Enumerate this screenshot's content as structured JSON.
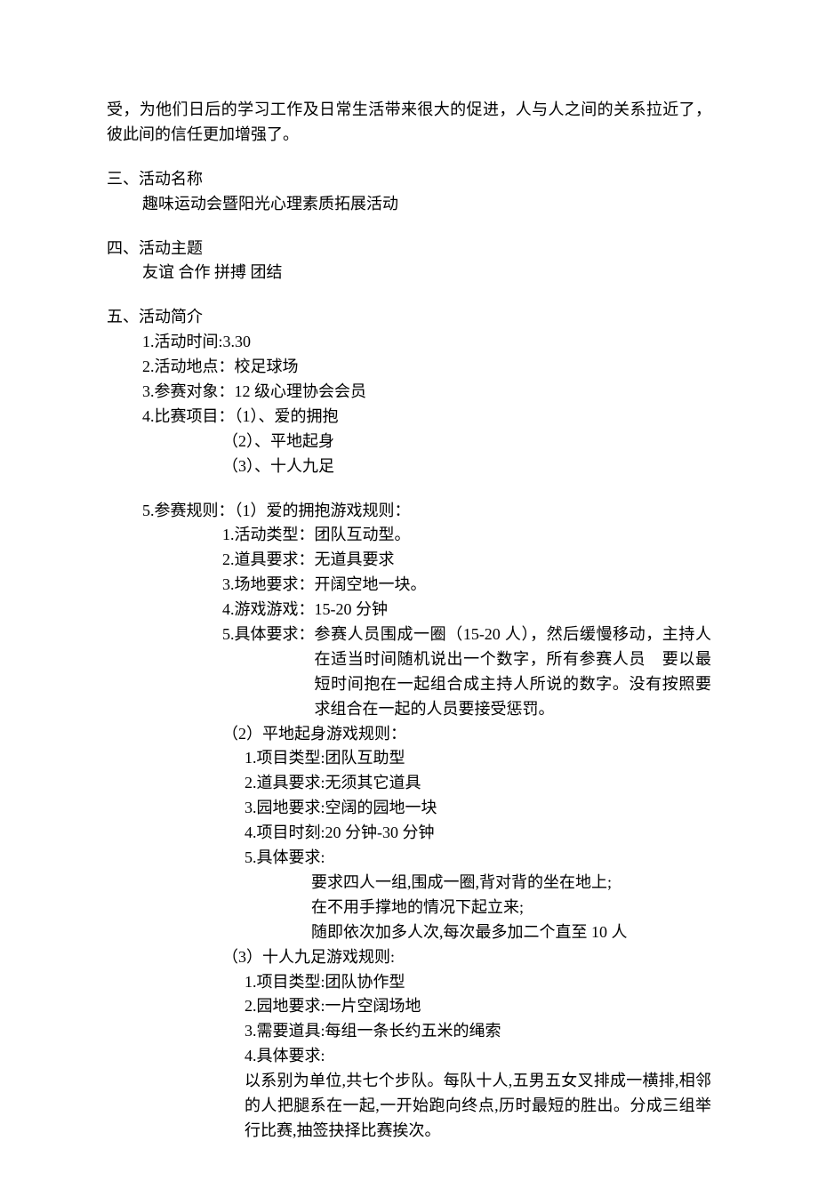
{
  "intro_para": "受，为他们日后的学习工作及日常生活带来很大的促进，人与人之间的关系拉近了，彼此间的信任更加增强了。",
  "s3": {
    "heading": "三、活动名称",
    "body": "趣味运动会暨阳光心理素质拓展活动"
  },
  "s4": {
    "heading": "四、活动主题",
    "body": "友谊 合作 拼搏 团结"
  },
  "s5": {
    "heading": "五、活动简介",
    "item1": "1.活动时间:3.30",
    "item2": "2.活动地点：校足球场",
    "item3": "3.参赛对象：12 级心理协会会员",
    "item4": "4.比赛项目：（1）、爱的拥抱",
    "item4b": "（2）、平地起身",
    "item4c": "（3）、十人九足",
    "item5": "5.参赛规则：（1）爱的拥抱游戏规则：",
    "g1": {
      "l1": "1.活动类型：团队互动型。",
      "l2": "2.道具要求：无道具要求",
      "l3": "3.场地要求：开阔空地一块。",
      "l4": "4.游戏游戏：15-20 分钟",
      "l5label": "5.具体要求：",
      "l5body": "参赛人员围成一圈（15-20 人），然后缓慢移动，主持人在适当时间随机说出一个数字，所有参赛人员　要以最短时间抱在一起组合成主持人所说的数字。没有按照要求组合在一起的人员要接受惩罚。"
    },
    "g2": {
      "head": "（2）平地起身游戏规则：",
      "l1": "1.项目类型:团队互助型",
      "l2": "2.道具要求:无须其它道具",
      "l3": "3.园地要求:空阔的园地一块",
      "l4": "4.项目时刻:20 分钟-30 分钟",
      "l5": "5.具体要求:",
      "b1": "要求四人一组,围成一圈,背对背的坐在地上;",
      "b2": "在不用手撑地的情况下起立来;",
      "b3": "随即依次加多人次,每次最多加二个直至 10 人"
    },
    "g3": {
      "head": "（3）十人九足游戏规则:",
      "l1": "1.项目类型:团队协作型",
      "l2": "2.园地要求:一片空阔场地",
      "l3": "3.需要道具:每组一条长约五米的绳索",
      "l4": "4.具体要求:",
      "body": "以系别为单位,共七个步队。每队十人,五男五女叉排成一横排,相邻的人把腿系在一起,一开始跑向终点,历时最短的胜出。分成三组举行比赛,抽签抉择比赛挨次。"
    }
  }
}
